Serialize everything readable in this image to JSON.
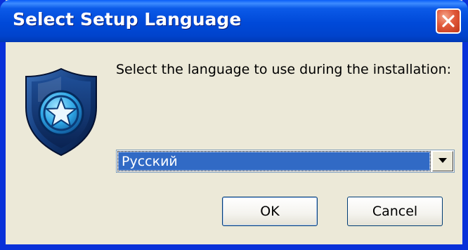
{
  "window": {
    "title": "Select Setup Language"
  },
  "dialog": {
    "prompt": "Select the language to use during the installation:",
    "language_select": {
      "selected_value": "Русский"
    },
    "ok_label": "OK",
    "cancel_label": "Cancel"
  },
  "icons": {
    "app_icon": "shield-star-icon",
    "close": "close-icon",
    "dropdown": "chevron-down-icon"
  },
  "colors": {
    "titlebar": "#0049d8",
    "frame": "#0831d9",
    "selection": "#316ac5",
    "close_button": "#e1593a",
    "background": "#ece9d8"
  }
}
